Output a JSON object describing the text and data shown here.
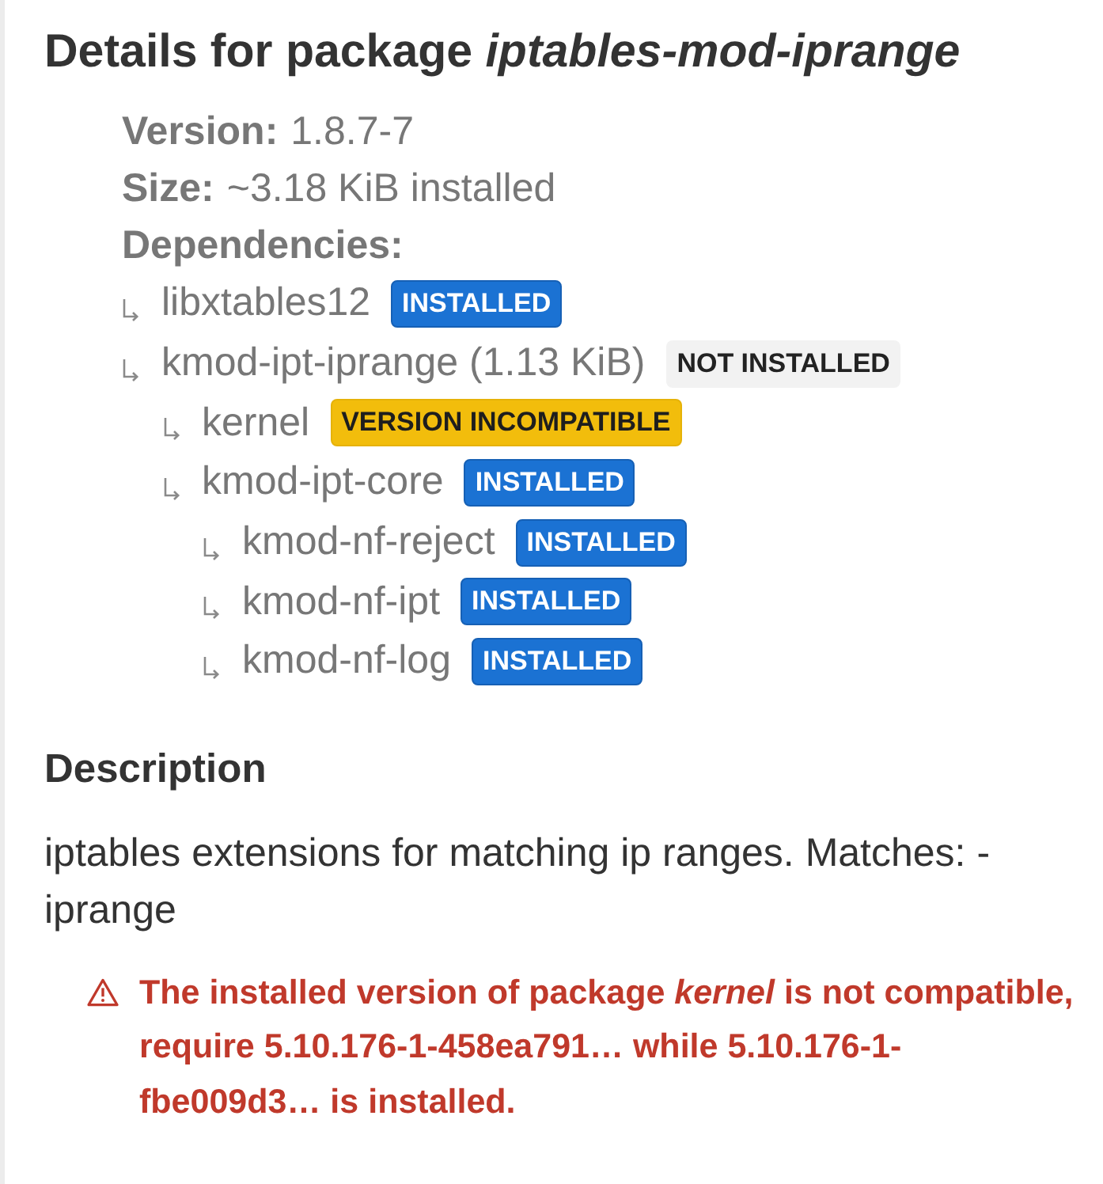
{
  "title": "Details for package *iptables-mod-iprange*",
  "info": [
    {
      "label": "Version:",
      "value": "1.8.7-7"
    },
    {
      "label": "Size:",
      "value": "~3.18 KiB installed"
    }
  ],
  "dependencies": {
    "label": "Dependencies:",
    "items": [
      {
        "name": "libxtables12",
        "badge": {
          "kind": "installed",
          "text": "INSTALLED"
        }
      },
      {
        "name": "kmod-ipt-iprange (1.13 KiB)",
        "badge": {
          "kind": "not_installed",
          "text": "NOT INSTALLED"
        },
        "children": [
          {
            "name": "kernel",
            "badge": {
              "kind": "incompatible",
              "text": "VERSION INCOMPATIBLE"
            }
          },
          {
            "name": "kmod-ipt-core",
            "badge": {
              "kind": "installed",
              "text": "INSTALLED"
            },
            "children": [
              {
                "name": "kmod-nf-reject",
                "badge": {
                  "kind": "installed",
                  "text": "INSTALLED"
                }
              },
              {
                "name": "kmod-nf-ipt",
                "badge": {
                  "kind": "installed",
                  "text": "INSTALLED"
                }
              },
              {
                "name": "kmod-nf-log",
                "badge": {
                  "kind": "installed",
                  "text": "INSTALLED"
                }
              }
            ]
          }
        ]
      }
    ]
  },
  "description": {
    "heading": "Description",
    "text": "iptables extensions for matching ip ranges. Matches: -iprange"
  },
  "warning": {
    "text": "The installed version of package *kernel* is not compatible, require 5.10.176-1-458ea791… while 5.10.176-1-fbe009d3… is installed."
  }
}
